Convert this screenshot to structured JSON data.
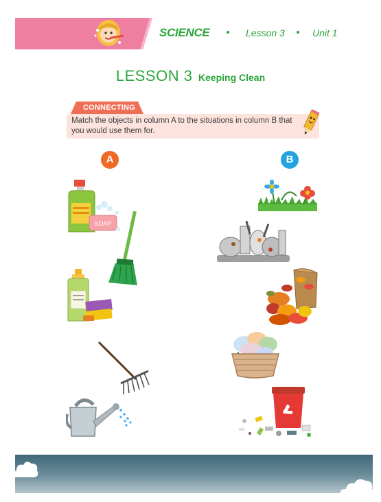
{
  "header": {
    "subject": "SCIENCE",
    "lesson": "Lesson 3",
    "unit": "Unit 1"
  },
  "title": {
    "lesson": "LESSON 3",
    "topic": "Keeping Clean"
  },
  "activity": {
    "label": "CONNECTING",
    "instruction": "Match the objects in column A to the situations in column B that you would use them for."
  },
  "columns": {
    "a": "A",
    "b": "B"
  },
  "items_a": [
    {
      "name": "detergent-and-soap",
      "soap_text": "SOAP"
    },
    {
      "name": "broom"
    },
    {
      "name": "dish-soap-and-sponge"
    },
    {
      "name": "rake"
    },
    {
      "name": "watering-can"
    }
  ],
  "items_b": [
    {
      "name": "flowers-on-grass"
    },
    {
      "name": "dirty-dishes"
    },
    {
      "name": "fallen-leaves"
    },
    {
      "name": "laundry-basket"
    },
    {
      "name": "trash-bin-with-litter"
    }
  ],
  "colors": {
    "green": "#2aa63b",
    "pink_banner": "#ef7fa0",
    "connect_tab": "#ef6f56",
    "connect_box": "#fde3de",
    "badge_a": "#f06a27",
    "badge_b": "#23a4e0",
    "footer": "#4d7385"
  }
}
